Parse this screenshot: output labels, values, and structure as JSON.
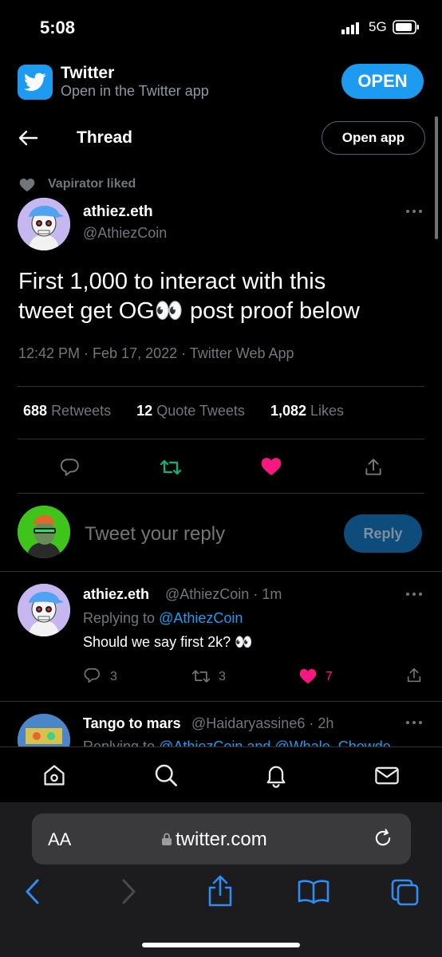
{
  "status_bar": {
    "time": "5:08",
    "network": "5G"
  },
  "app_banner": {
    "title": "Twitter",
    "subtitle": "Open in the Twitter app",
    "open_label": "OPEN"
  },
  "header": {
    "title": "Thread",
    "open_app_label": "Open app"
  },
  "social_context": "Vapirator liked",
  "tweet": {
    "author_name": "athiez.eth",
    "author_handle": "@AthiezCoin",
    "text_line1": "First 1,000 to interact with this",
    "text_line2a": "tweet get OG",
    "text_emoji": "👀",
    "text_line2b": " post proof below",
    "meta": "12:42 PM · Feb 17, 2022 · Twitter Web App",
    "retweets_count": "688",
    "retweets_label": "Retweets",
    "quotes_count": "12",
    "quotes_label": "Quote Tweets",
    "likes_count": "1,082",
    "likes_label": "Likes"
  },
  "composer": {
    "placeholder": "Tweet your reply",
    "reply_label": "Reply"
  },
  "replies": [
    {
      "author_name": "athiez.eth",
      "meta": "@AthiezCoin · 1m",
      "replying_prefix": "Replying to ",
      "replying_to": "@AthiezCoin",
      "text": "Should we say first 2k? 👀",
      "reply_count": "3",
      "retweet_count": "3",
      "like_count": "7"
    },
    {
      "author_name": "Tango to mars",
      "meta": "@Haidaryassine6 · 2h",
      "replying_prefix": "Replying to ",
      "replying_to": "@AthiezCoin and @Whale_Chowde"
    }
  ],
  "browser": {
    "aa_label": "AA",
    "url": "twitter.com"
  },
  "colors": {
    "accent": "#1d9bf0",
    "like": "#f91880",
    "retweet": "#00ba7c",
    "background": "#000000"
  }
}
